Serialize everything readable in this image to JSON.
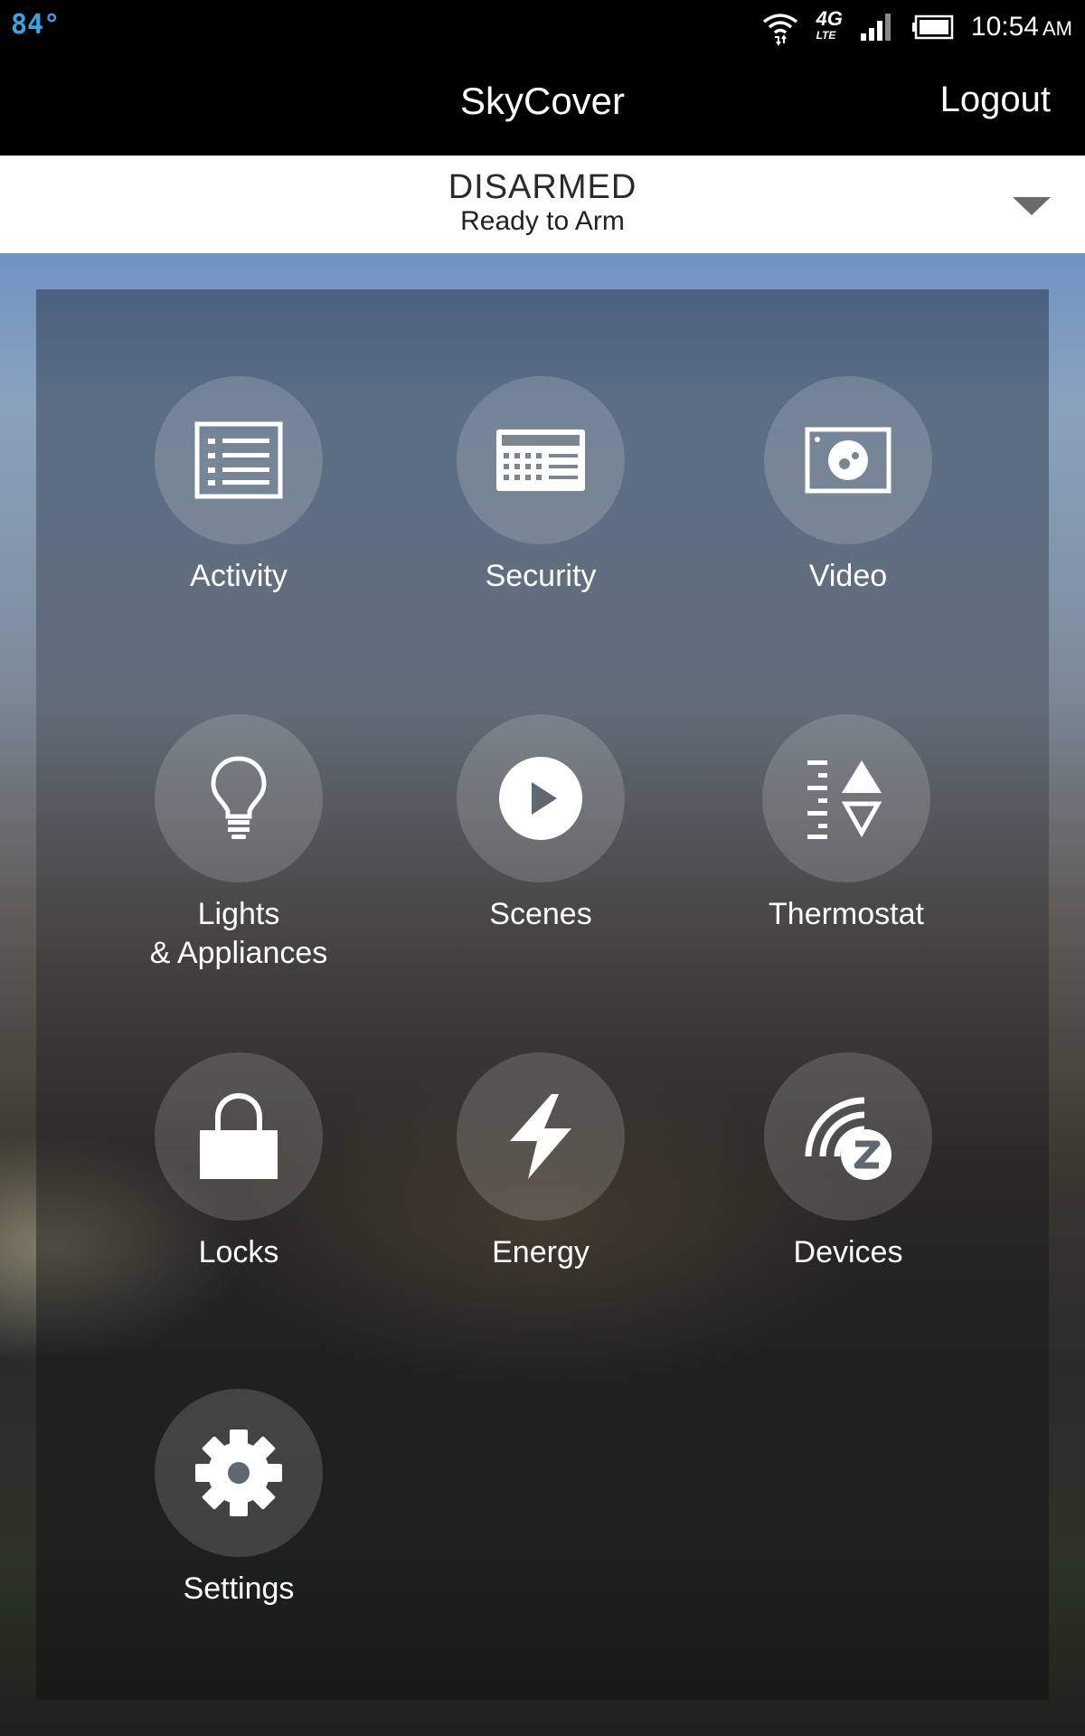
{
  "status_bar": {
    "temperature": "84°",
    "network": "4G",
    "network_sub": "LTE",
    "time": "10:54",
    "ampm": "AM"
  },
  "header": {
    "title": "SkyCover",
    "logout_label": "Logout"
  },
  "arm_status": {
    "state": "DISARMED",
    "substate": "Ready to Arm"
  },
  "tiles": [
    {
      "label": "Activity",
      "icon": "activity-list-icon"
    },
    {
      "label": "Security",
      "icon": "security-keypad-icon"
    },
    {
      "label": "Video",
      "icon": "video-camera-icon"
    },
    {
      "label": "Lights\n& Appliances",
      "icon": "lightbulb-icon"
    },
    {
      "label": "Scenes",
      "icon": "play-icon"
    },
    {
      "label": "Thermostat",
      "icon": "thermostat-icon"
    },
    {
      "label": "Locks",
      "icon": "lock-icon"
    },
    {
      "label": "Energy",
      "icon": "lightning-bolt-icon"
    },
    {
      "label": "Devices",
      "icon": "zwave-devices-icon"
    },
    {
      "label": "Settings",
      "icon": "gear-icon"
    }
  ]
}
